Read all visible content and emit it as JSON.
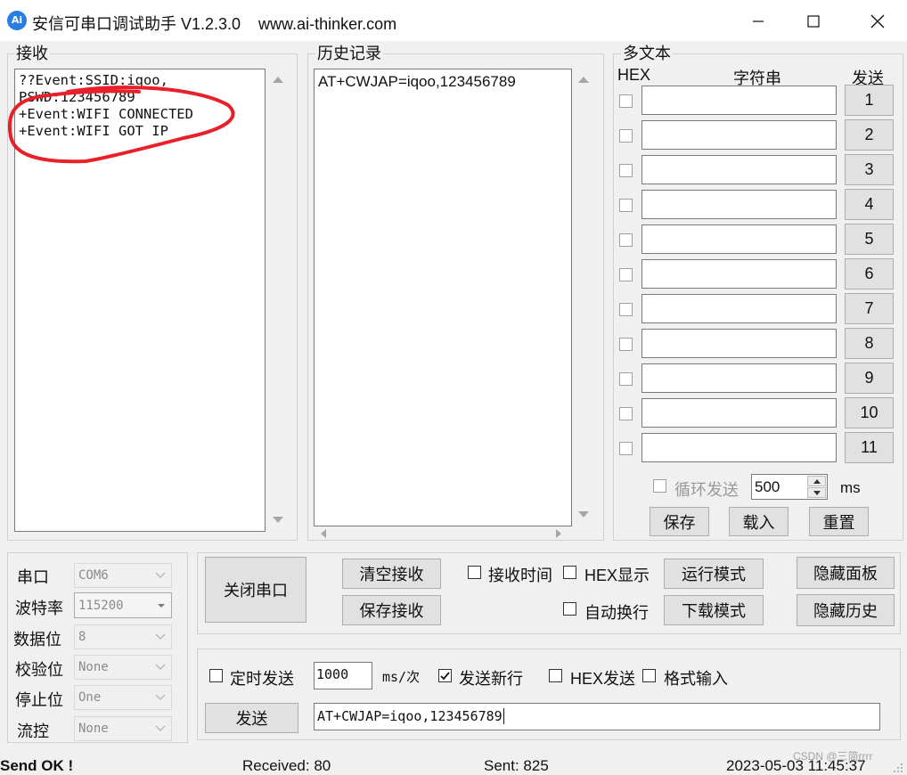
{
  "window": {
    "icon_text": "Ai",
    "title": "安信可串口调试助手 V1.2.3.0    www.ai-thinker.com"
  },
  "receive": {
    "label": "接收",
    "text": "??Event:SSID:iqoo,\nPSWD:123456789\n+Event:WIFI CONNECTED\n+Event:WIFI GOT IP"
  },
  "history": {
    "label": "历史记录",
    "text": "AT+CWJAP=iqoo,123456789"
  },
  "multi": {
    "label": "多文本",
    "col_hex": "HEX",
    "col_string": "字符串",
    "col_send": "发送",
    "rows": [
      {
        "num": "1",
        "value": ""
      },
      {
        "num": "2",
        "value": ""
      },
      {
        "num": "3",
        "value": ""
      },
      {
        "num": "4",
        "value": ""
      },
      {
        "num": "5",
        "value": ""
      },
      {
        "num": "6",
        "value": ""
      },
      {
        "num": "7",
        "value": ""
      },
      {
        "num": "8",
        "value": ""
      },
      {
        "num": "9",
        "value": ""
      },
      {
        "num": "10",
        "value": ""
      },
      {
        "num": "11",
        "value": ""
      }
    ],
    "loop_send_label": "循环发送",
    "loop_interval": "500",
    "loop_unit": "ms",
    "save_label": "保存",
    "load_label": "载入",
    "reset_label": "重置"
  },
  "serial": {
    "port_label": "串口",
    "port_value": "COM6",
    "baud_label": "波特率",
    "baud_value": "115200",
    "databits_label": "数据位",
    "databits_value": "8",
    "parity_label": "校验位",
    "parity_value": "None",
    "stopbits_label": "停止位",
    "stopbits_value": "One",
    "flow_label": "流控",
    "flow_value": "None"
  },
  "controls": {
    "close_port": "关闭串口",
    "clear_receive": "清空接收",
    "save_receive": "保存接收",
    "receive_time": "接收时间",
    "hex_display": "HEX显示",
    "auto_wrap": "自动换行",
    "run_mode": "运行模式",
    "download_mode": "下载模式",
    "hide_panel": "隐藏面板",
    "hide_history": "隐藏历史"
  },
  "send": {
    "timed_send": "定时发送",
    "interval": "1000",
    "interval_unit": "ms/次",
    "send_newline": "发送新行",
    "send_newline_checked": true,
    "hex_send": "HEX发送",
    "format_input": "格式输入",
    "send_button": "发送",
    "input_value": "AT+CWJAP=iqoo,123456789"
  },
  "status": {
    "message": "Send OK !",
    "received": "Received: 80",
    "sent": "Sent: 825",
    "datetime": "2023-05-03 11:45:37",
    "watermark": "CSDN @三简rrrr"
  },
  "colors": {
    "annotation": "#e8202a",
    "accent": "#2a7de1"
  }
}
